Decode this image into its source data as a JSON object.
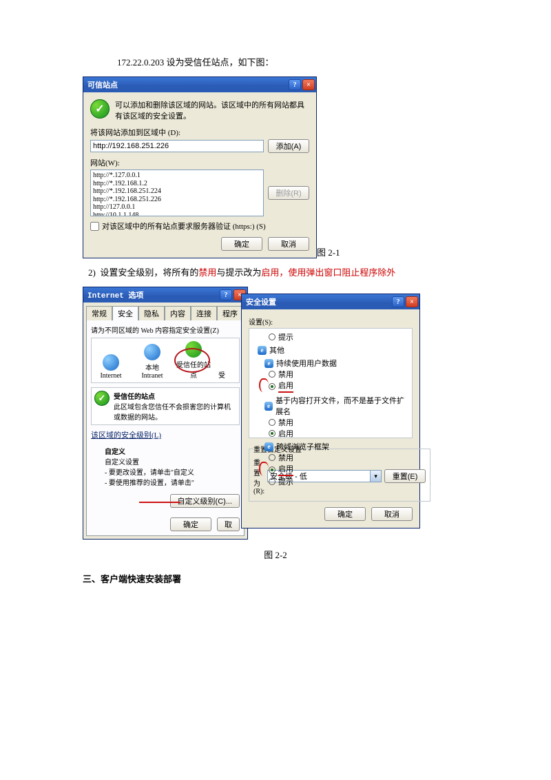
{
  "intro": "172.22.0.203 设为受信任站点，如下图：",
  "dlg1": {
    "title": "可信站点",
    "desc": "可以添加和删除该区域的网站。该区域中的所有网站都具有该区域的安全设置。",
    "addLabel": "将该网站添加到区域中 (D):",
    "addValue": "http://192.168.251.226",
    "addBtn": "添加(A)",
    "sitesLabel": "网站(W):",
    "sites": [
      "http://*.127.0.0.1",
      "http://*.192.168.1.2",
      "http://*.192.168.251.224",
      "http://*.192.168.251.226",
      "http://127.0.0.1",
      "http://10.1.1.148"
    ],
    "removeBtn": "删除(R)",
    "https": "对该区域中的所有站点要求服务器验证 (https:) (S)",
    "ok": "确定",
    "cancel": "取消"
  },
  "fig1": "图 2-1",
  "step2": {
    "num": "2)",
    "a": "设置安全级别，将所有的",
    "b": "禁用",
    "c": "与提示改为",
    "d": "启用",
    "e": "，使用弹出窗口阻止程序除外"
  },
  "dlg2": {
    "title": "Internet 选项",
    "tabs": [
      "常规",
      "安全",
      "隐私",
      "内容",
      "连接",
      "程序"
    ],
    "prompt": "请为不同区域的 Web 内容指定安全设置(Z)",
    "zones": [
      "Internet",
      "本地 Intranet",
      "受信任的站点",
      "受"
    ],
    "zoneTitle": "受信任的站点",
    "zoneDesc": "此区域包含您信任不会损害您的计算机或数据的网站。",
    "levelLink": "该区域的安全级别(L)",
    "custom": "自定义",
    "customDesc1": "自定义设置",
    "customDesc2": "- 要更改设置，请单击\"自定义",
    "customDesc3": "- 要使用推荐的设置，请单击\"",
    "customBtn": "自定义级别(C)...",
    "ok": "确定",
    "cancel": "取"
  },
  "dlg3": {
    "title": "安全设置",
    "setLabel": "设置(S):",
    "items": {
      "prompt": "提示",
      "group": "其他",
      "persist": "持续使用用户数据",
      "disable": "禁用",
      "enable": "启用",
      "openByContent": "基于内容打开文件，而不是基于文件扩展名",
      "crossFrame": "跨域浏览子框架"
    },
    "resetGroup": "重置自定义设置",
    "resetTo": "重置为(R):",
    "resetVal": "安全级 - 低",
    "resetBtn": "重置(E)",
    "ok": "确定",
    "cancel": "取消"
  },
  "fig2": "图 2-2",
  "h3": "三、客户端快速安装部署"
}
